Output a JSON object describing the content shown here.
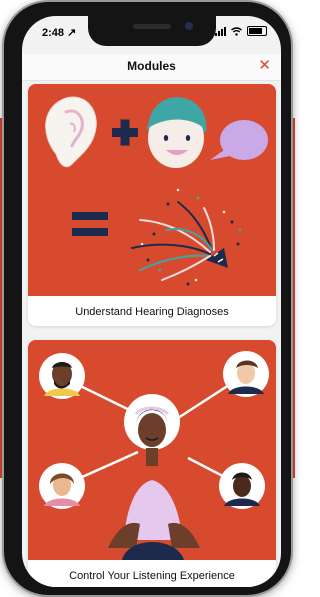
{
  "status_bar": {
    "time": "2:48 ↗"
  },
  "nav": {
    "title": "Modules",
    "close_label": "✕"
  },
  "cards": [
    {
      "title": "Understand Hearing Diagnoses",
      "icon": "hearing-diagnosis-illustration"
    },
    {
      "title": "Control Your Listening Experience",
      "icon": "listening-experience-illustration"
    }
  ],
  "colors": {
    "accent": "#d84a2e",
    "navy": "#1d2a4d",
    "lilac": "#c9a9e6",
    "teal": "#3ea7a6"
  }
}
